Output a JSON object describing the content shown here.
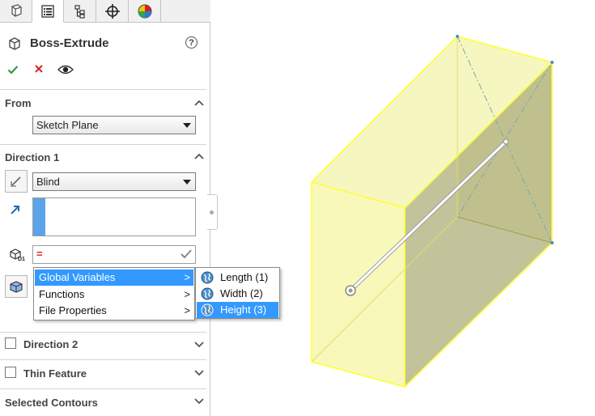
{
  "feature": {
    "title": "Boss-Extrude"
  },
  "tabs": [
    {
      "name": "feature-manager-tab"
    },
    {
      "name": "property-manager-tab"
    },
    {
      "name": "configuration-manager-tab"
    },
    {
      "name": "dimxpert-manager-tab"
    },
    {
      "name": "display-manager-tab"
    }
  ],
  "sections": {
    "from": {
      "title": "From",
      "start_condition": "Sketch Plane"
    },
    "direction1": {
      "title": "Direction 1",
      "end_condition": "Blind",
      "depth_equation": "="
    },
    "direction2": {
      "title": "Direction 2"
    },
    "thin_feature": {
      "title": "Thin Feature"
    },
    "selected_contours": {
      "title": "Selected Contours"
    }
  },
  "menu": {
    "items": [
      {
        "label": "Global Variables",
        "submenu": ">"
      },
      {
        "label": "Functions",
        "submenu": ">"
      },
      {
        "label": "File Properties",
        "submenu": ">"
      }
    ],
    "global_variables": [
      {
        "label": "Length (1)"
      },
      {
        "label": "Width (2)"
      },
      {
        "label": "Height (3)"
      }
    ]
  },
  "colors": {
    "highlight": "#3399ff",
    "part_yellow": "#ffff44",
    "part_fill": "#f5f5a8"
  }
}
